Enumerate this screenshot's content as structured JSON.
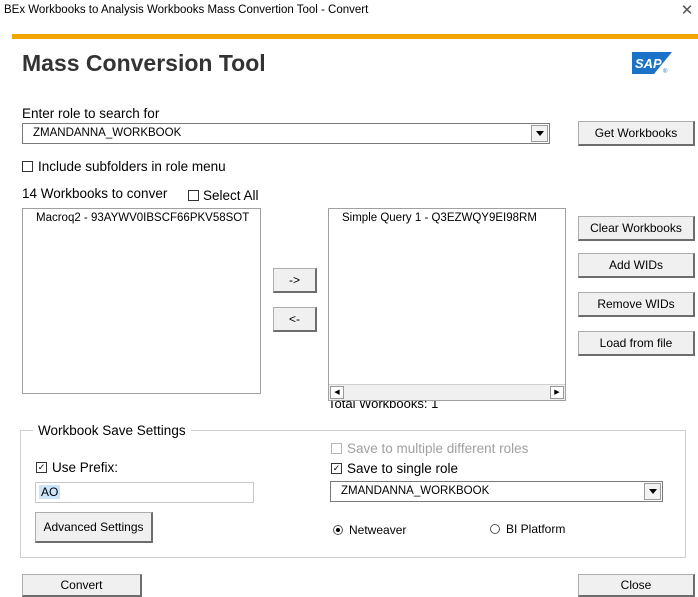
{
  "window": {
    "title": "BEx Workbooks to Analysis Workbooks Mass Convertion Tool - Convert",
    "close_glyph": "✕"
  },
  "header": {
    "title": "Mass Conversion Tool",
    "logo_text": "SAP",
    "logo_color": "#1a73c9"
  },
  "role_search": {
    "label": "Enter role to search for",
    "selected_role": "ZMANDANNA_WORKBOOK",
    "get_workbooks_label": "Get Workbooks",
    "include_subfolders_label": "Include subfolders in role menu",
    "include_subfolders_checked": false
  },
  "workbooks": {
    "count_label": "14 Workbooks to conver",
    "select_all_label": "Select All",
    "select_all_checked": false,
    "available": [
      "Macroq2 - 93AYWV0IBSCF66PKV58SOT"
    ],
    "move_right_label": "->",
    "move_left_label": "<-",
    "selected": [
      "Simple Query 1 - Q3EZWQY9EI98RM"
    ],
    "total_label": "Total Workbooks: 1"
  },
  "side_buttons": {
    "clear": "Clear Workbooks",
    "add_wids": "Add WIDs",
    "remove_wids": "Remove WIDs",
    "load_file": "Load from file"
  },
  "save_settings": {
    "legend": "Workbook Save Settings",
    "use_prefix_label": "Use Prefix:",
    "use_prefix_checked": true,
    "prefix_value": "AO",
    "advanced_label": "Advanced Settings",
    "multi_roles_label": "Save to multiple different roles",
    "multi_roles_checked": false,
    "single_role_label": "Save to single role",
    "single_role_checked": true,
    "single_role_value": "ZMANDANNA_WORKBOOK",
    "platform_netweaver": "Netweaver",
    "platform_bi": "BI Platform",
    "platform_selected": "Netweaver"
  },
  "footer": {
    "convert": "Convert",
    "close": "Close"
  }
}
